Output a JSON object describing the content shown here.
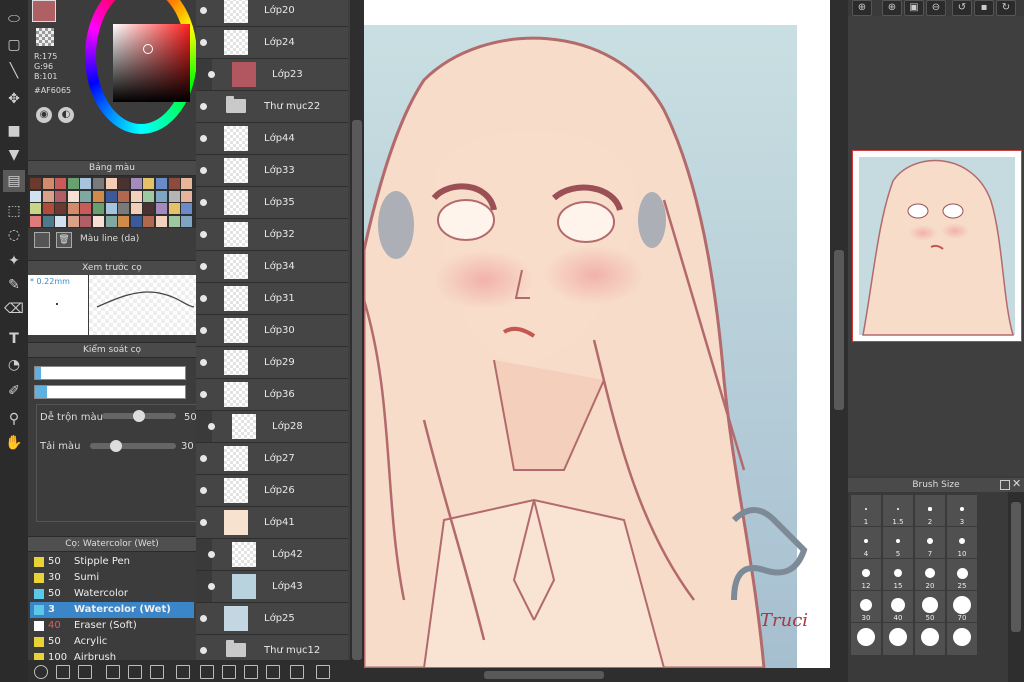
{
  "color": {
    "r_label": "R:175",
    "g_label": "G:96",
    "b_label": "B:101",
    "hex_label": "#AF6065",
    "main_hex": "#AF6065"
  },
  "palette": {
    "title": "Bảng màu",
    "name": "Màu line (da)"
  },
  "brush_preview": {
    "title": "Xem trước cọ",
    "size": "* 0.22mm"
  },
  "brush_control": {
    "title": "Kiểm soát cọ",
    "blend_label": "Dễ trộn màu",
    "blend_value": "50",
    "blend_level": 0.5,
    "load_label": "Tải màu",
    "load_value": "30",
    "load_level": 0.3
  },
  "brush_list": {
    "title": "Cọ: Watercolor (Wet)",
    "items": [
      {
        "size": "50",
        "name": "Stipple Pen",
        "color": "#e8d437"
      },
      {
        "size": "30",
        "name": "Sumi",
        "color": "#e8d437"
      },
      {
        "size": "50",
        "name": "Watercolor",
        "color": "#5bc8e8"
      },
      {
        "size": "3",
        "name": "Watercolor (Wet)",
        "color": "#5bc8e8"
      },
      {
        "size": "40",
        "name": "Eraser (Soft)",
        "color": "#ffffff"
      },
      {
        "size": "50",
        "name": "Acrylic",
        "color": "#e8d437"
      },
      {
        "size": "100",
        "name": "Airbrush",
        "color": "#e8d437"
      }
    ]
  },
  "layers": [
    {
      "name": "Lớp20",
      "indent": 0,
      "type": "layer",
      "fill": ""
    },
    {
      "name": "Lớp24",
      "indent": 0,
      "type": "layer",
      "fill": ""
    },
    {
      "name": "Lớp23",
      "indent": 1,
      "type": "layer",
      "fill": "#b2575f"
    },
    {
      "name": "Thư mục22",
      "indent": 0,
      "type": "folder",
      "fill": ""
    },
    {
      "name": "Lớp44",
      "indent": 0,
      "type": "layer",
      "fill": ""
    },
    {
      "name": "Lớp33",
      "indent": 0,
      "type": "layer",
      "fill": ""
    },
    {
      "name": "Lớp35",
      "indent": 0,
      "type": "layer",
      "fill": ""
    },
    {
      "name": "Lớp32",
      "indent": 0,
      "type": "layer",
      "fill": ""
    },
    {
      "name": "Lớp34",
      "indent": 0,
      "type": "layer",
      "fill": ""
    },
    {
      "name": "Lớp31",
      "indent": 0,
      "type": "layer",
      "fill": ""
    },
    {
      "name": "Lớp30",
      "indent": 0,
      "type": "layer",
      "fill": ""
    },
    {
      "name": "Lớp29",
      "indent": 0,
      "type": "layer",
      "fill": ""
    },
    {
      "name": "Lớp36",
      "indent": 0,
      "type": "layer",
      "fill": ""
    },
    {
      "name": "Lớp28",
      "indent": 1,
      "type": "layer",
      "fill": ""
    },
    {
      "name": "Lớp27",
      "indent": 0,
      "type": "layer",
      "fill": ""
    },
    {
      "name": "Lớp26",
      "indent": 0,
      "type": "layer",
      "fill": ""
    },
    {
      "name": "Lớp41",
      "indent": 0,
      "type": "layer",
      "fill": "#f6e2cf"
    },
    {
      "name": "Lớp42",
      "indent": 1,
      "type": "layer",
      "fill": ""
    },
    {
      "name": "Lớp43",
      "indent": 1,
      "type": "layer",
      "fill": "#b9d3de"
    },
    {
      "name": "Lớp25",
      "indent": 0,
      "type": "layer",
      "fill": "#c5d6e3"
    },
    {
      "name": "Thư mục12",
      "indent": 0,
      "type": "folder",
      "fill": ""
    }
  ],
  "brush_size": {
    "title": "Brush Size",
    "sizes": [
      "1",
      "1.5",
      "2",
      "3",
      "4",
      "5",
      "7",
      "10",
      "12",
      "15",
      "20",
      "25",
      "30",
      "40",
      "50",
      "70"
    ]
  },
  "canvas": {
    "signature": "Truci"
  }
}
